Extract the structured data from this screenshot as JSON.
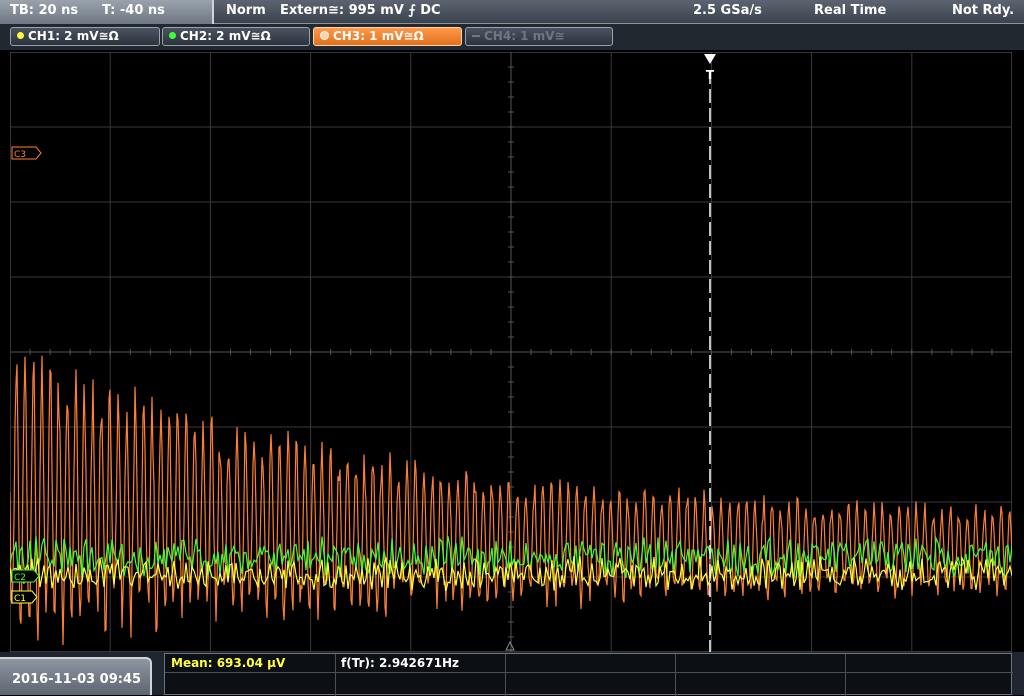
{
  "header": {
    "timebase": "TB: 20 ns",
    "trigger_time": "T: -40 ns",
    "trigger_mode": "Norm",
    "trigger_source": "Extern≅: 995 mV ⨍ DC",
    "sample_rate": "2.5 GSa/s",
    "acq_mode": "Real Time",
    "status": "Not Rdy."
  },
  "channels": [
    {
      "label": "CH1: 2 mV≅Ω",
      "color": "#ffff40",
      "state": "on"
    },
    {
      "label": "CH2: 2 mV≅Ω",
      "color": "#40ff40",
      "state": "on"
    },
    {
      "label": "CH3: 1 mV≅Ω",
      "color": "#ff8a3a",
      "state": "selected"
    },
    {
      "label": "CH4: 1 mV≅",
      "color": "#6f7780",
      "state": "off"
    }
  ],
  "markers": {
    "ch3": "C3",
    "ch2": "C2",
    "ch1": "C1",
    "trigger": "T"
  },
  "footer": {
    "datetime": "2016-11-03 09:45",
    "measurements": [
      {
        "label": "Mean: 693.04 µV",
        "color": "#ffff40"
      },
      {
        "label": "f(Tr): 2.942671Hz",
        "color": "#ffffff"
      }
    ]
  },
  "colors": {
    "ch1": "#ffff3c",
    "ch2": "#3cff3c",
    "ch3": "#ff7f32",
    "grid": "#3a3a3a"
  }
}
